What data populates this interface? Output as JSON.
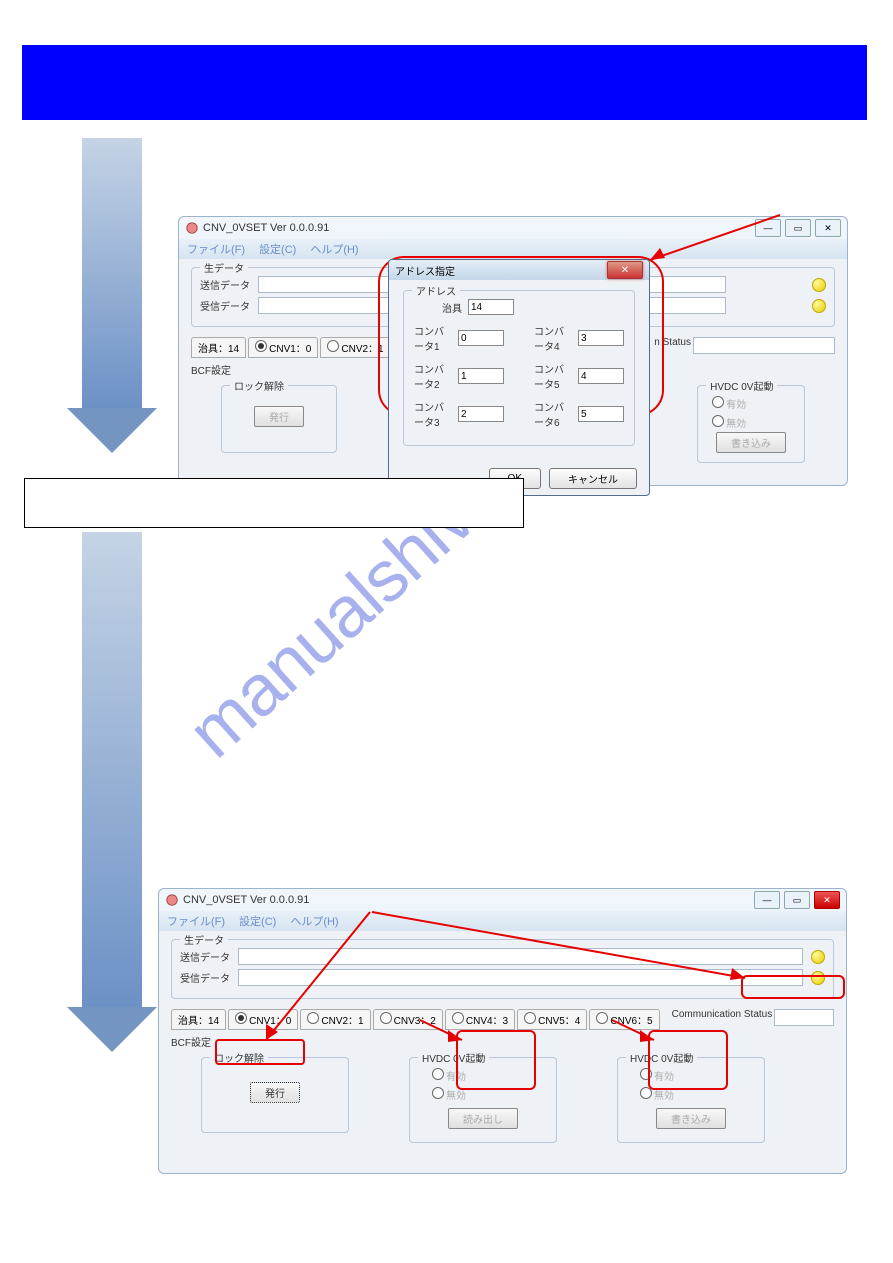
{
  "banner_text": "",
  "window1": {
    "title": "CNV_0VSET Ver 0.0.0.91",
    "menu": {
      "file": "ファイル(F)",
      "settings": "設定(C)",
      "help": "ヘルプ(H)"
    },
    "raw_data_legend": "生データ",
    "send_data_label": "送信データ",
    "recv_data_label": "受信データ",
    "tabs": {
      "jig": "治具：14",
      "cnv1": "CNV1：0",
      "cnv2": "CNV2：1"
    },
    "status_label": "n Status",
    "bcf_legend": "BCF設定",
    "lock_release_legend": "ロック解除",
    "issue_btn": "発行",
    "hvdc_group_legend": "HVDC 0V起動",
    "radio_valid": "有効",
    "radio_invalid": "無効",
    "write_btn": "書き込み"
  },
  "dialog": {
    "title": "アドレス指定",
    "address_legend": "アドレス",
    "jig_label": "治具",
    "jig_value": "14",
    "conv1_label": "コンバータ1",
    "conv1_value": "0",
    "conv2_label": "コンバータ2",
    "conv2_value": "1",
    "conv3_label": "コンバータ3",
    "conv3_value": "2",
    "conv4_label": "コンバータ4",
    "conv4_value": "3",
    "conv5_label": "コンバータ5",
    "conv5_value": "4",
    "conv6_label": "コンバータ6",
    "conv6_value": "5",
    "ok_btn": "OK",
    "cancel_btn": "キャンセル"
  },
  "textbox": "",
  "window2": {
    "title": "CNV_0VSET Ver 0.0.0.91",
    "menu": {
      "file": "ファイル(F)",
      "settings": "設定(C)",
      "help": "ヘルプ(H)"
    },
    "raw_data_legend": "生データ",
    "send_data_label": "送信データ",
    "recv_data_label": "受信データ",
    "tabs": {
      "jig": "治具：14",
      "cnv1": "CNV1：0",
      "cnv2": "CNV2：1",
      "cnv3": "CNV3：2",
      "cnv4": "CNV4：3",
      "cnv5": "CNV5：4",
      "cnv6": "CNV6：5"
    },
    "comm_status_label": "Communication Status",
    "bcf_legend": "BCF設定",
    "lock_release_legend": "ロック解除",
    "issue_btn": "発行",
    "hvdc1_legend": "HVDC 0V起動",
    "hvdc2_legend": "HVDC 0V起動",
    "radio_valid": "有効",
    "radio_invalid": "無効",
    "read_btn": "読み出し",
    "write_btn": "書き込み"
  },
  "watermark": "manualshive.com"
}
